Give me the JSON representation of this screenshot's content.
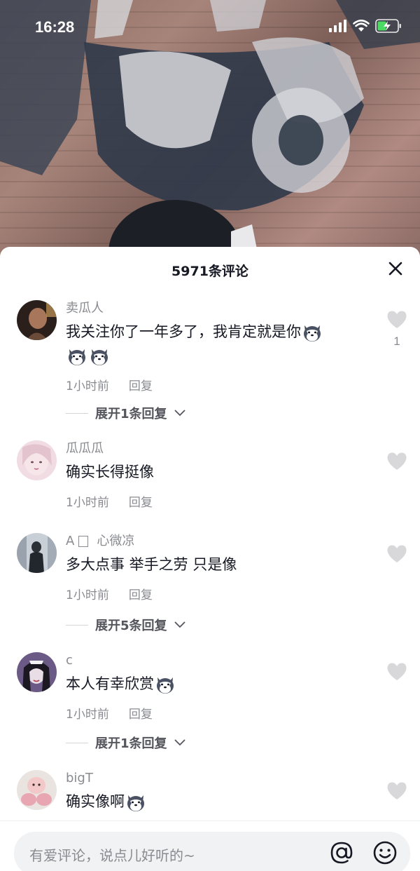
{
  "status": {
    "time": "16:28"
  },
  "sheet": {
    "title": "5971条评论"
  },
  "comments": [
    {
      "name": "卖瓜人",
      "text": "我关注你了一年多了，我肯定就是你",
      "time": "1小时前",
      "reply": "回复",
      "likes": "1",
      "expand": "展开1条回复"
    },
    {
      "name": "瓜瓜瓜",
      "text": "确实长得挺像",
      "time": "1小时前",
      "reply": "回复"
    },
    {
      "name_prefix": "A",
      "name": "心微凉",
      "text": "多大点事 举手之劳 只是像",
      "time": "1小时前",
      "reply": "回复",
      "expand": "展开5条回复"
    },
    {
      "name": "c",
      "text": "本人有幸欣赏",
      "time": "1小时前",
      "reply": "回复",
      "expand": "展开1条回复"
    },
    {
      "name": "bigT",
      "text": "确实像啊"
    }
  ],
  "input": {
    "placeholder": "有爱评论，说点儿好听的~"
  },
  "icons": {
    "close": "close-icon",
    "heart": "heart-icon",
    "chevron": "chevron-down-icon",
    "at": "at-icon",
    "emoji": "emoji-icon",
    "husky": "husky-emoji"
  },
  "colors": {
    "secondary_text": "#8a8b91",
    "primary_text": "#161823",
    "heart": "#d8d8da"
  }
}
